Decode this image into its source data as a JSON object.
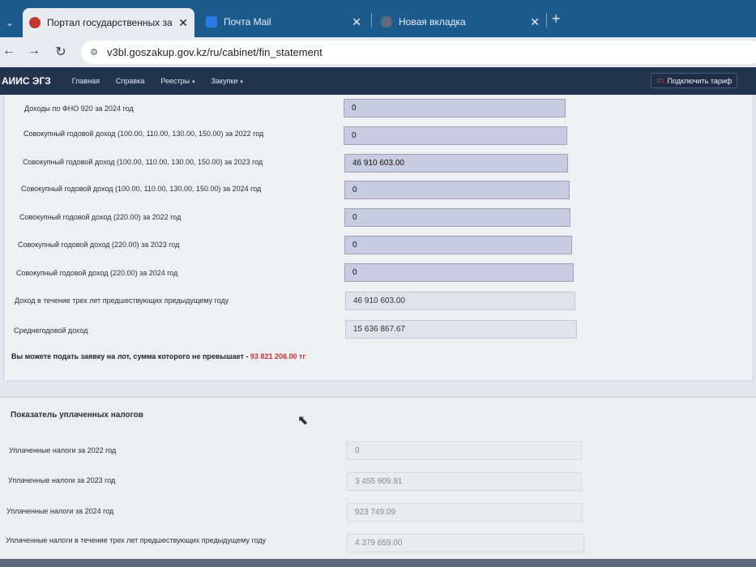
{
  "browser": {
    "tabs": [
      {
        "title": "Портал государственных закуп",
        "close": "✕",
        "active": true
      },
      {
        "title": "Почта Mail",
        "close": "✕",
        "active": false
      },
      {
        "title": "Новая вкладка",
        "close": "✕",
        "active": false
      }
    ],
    "new_tab": "+",
    "url": "v3bl.goszakup.gov.kz/ru/cabinet/fin_statement"
  },
  "site_nav": {
    "brand": "АИИС ЭГЗ",
    "items": [
      {
        "label": "Главная"
      },
      {
        "label": "Справка"
      },
      {
        "label": "Реестры",
        "caret": "▾"
      },
      {
        "label": "Закупки",
        "caret": "▾"
      }
    ],
    "tariff_button": "Подключить тариф"
  },
  "income": {
    "rows": [
      {
        "label": "Доходы по ФНО 920 за 2024 год",
        "value": "0"
      },
      {
        "label": "Совокупный годовой доход (100.00, 110.00, 130.00, 150.00) за 2022 год",
        "value": "0"
      },
      {
        "label": "Совокупный годовой доход (100.00, 110.00, 130.00, 150.00) за 2023 год",
        "value": "46 910 603.00"
      },
      {
        "label": "Совокупный годовой доход (100.00, 110.00, 130.00, 150.00) за 2024 год",
        "value": "0"
      },
      {
        "label": "Совокупный годовой доход (220.00) за 2022 год",
        "value": "0"
      },
      {
        "label": "Совокупный годовой доход (220.00) за 2023 год",
        "value": "0"
      },
      {
        "label": "Совокупный годовой доход (220.00) за 2024 год",
        "value": "0"
      },
      {
        "label": "Доход в течение трех лет предшествующих предыдущему году",
        "value": "46 910 603.00"
      },
      {
        "label": "Среднегодовой доход",
        "value": "15 636 867.67"
      }
    ],
    "limit_text": "Вы можете подать заявку на лот, сумма которого не превышает -",
    "limit_amount": "93 821 206.00 тг"
  },
  "taxes": {
    "title": "Показатель уплаченных налогов",
    "rows": [
      {
        "label": "Уплаченные налоги за 2022 год",
        "value": "0"
      },
      {
        "label": "Уплаченные налоги за 2023 год",
        "value": "3 455 909.91"
      },
      {
        "label": "Уплаченные налоги за 2024 год",
        "value": "923 749.09"
      },
      {
        "label": "Уплаченные налоги в течение трех лет предшествующих предыдущему году",
        "value": "4 379 659.00"
      }
    ]
  }
}
